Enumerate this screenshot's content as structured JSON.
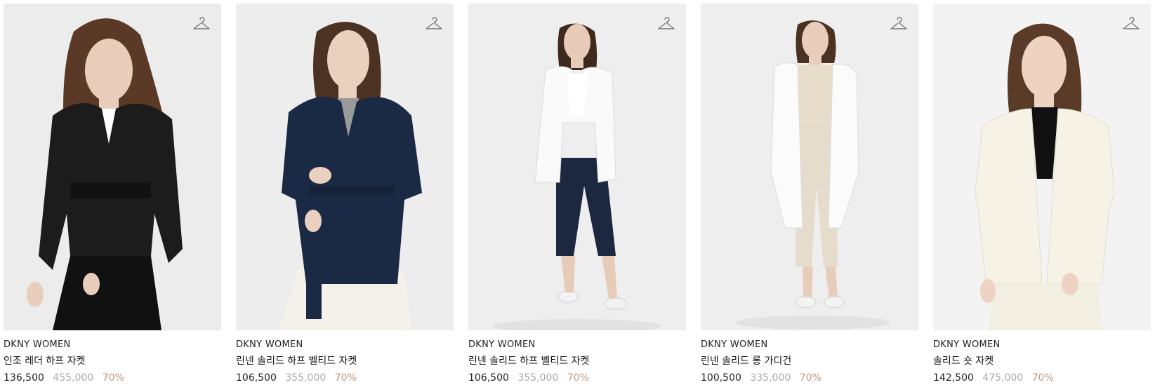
{
  "products": [
    {
      "brand": "DKNY WOMEN",
      "name": "인조 레더 하프 자켓",
      "price": "136,500",
      "original_price": "455,000",
      "discount": "70%",
      "image_alt": "black faux leather jacket",
      "colors": {
        "jacket": "#1c1c1c",
        "inner": "#ffffff",
        "bottom": "#111111",
        "hair": "#5a3a26",
        "skin": "#e9cdbb",
        "bg": "#ececec"
      },
      "icon": "hanger-icon"
    },
    {
      "brand": "DKNY WOMEN",
      "name": "린넨 솔리드 하프 벨티드 자켓",
      "price": "106,500",
      "original_price": "355,000",
      "discount": "70%",
      "image_alt": "navy linen belted jacket",
      "colors": {
        "jacket": "#1b2a44",
        "inner": "#9a9a9a",
        "bottom": "#f4f1ea",
        "hair": "#4b3222",
        "skin": "#ead0bf",
        "bg": "#ededed"
      },
      "icon": "hanger-icon"
    },
    {
      "brand": "DKNY WOMEN",
      "name": "린넨 솔리드 하프 벨티드 자켓",
      "price": "106,500",
      "original_price": "355,000",
      "discount": "70%",
      "image_alt": "white linen belted jacket",
      "colors": {
        "jacket": "#fafafa",
        "inner": "#ffffff",
        "bottom": "#1c2740",
        "hair": "#3e2a1d",
        "skin": "#e7cbb8",
        "bg": "#eeeeee"
      },
      "icon": "hanger-icon"
    },
    {
      "brand": "DKNY WOMEN",
      "name": "린넨 솔리드 롱 가디건",
      "price": "100,500",
      "original_price": "335,000",
      "discount": "70%",
      "image_alt": "white linen long cardigan",
      "colors": {
        "jacket": "#fbfbfb",
        "inner": "#e8dccb",
        "bottom": "#e6dccc",
        "hair": "#4a3122",
        "skin": "#e8cdbc",
        "bg": "#eeeeee"
      },
      "icon": "hanger-icon"
    },
    {
      "brand": "DKNY WOMEN",
      "name": "솔리드 숏 자켓",
      "price": "142,500",
      "original_price": "475,000",
      "discount": "70%",
      "image_alt": "cream short jacket",
      "colors": {
        "jacket": "#f6f2e6",
        "inner": "#111111",
        "bottom": "#f2eee2",
        "hair": "#5a3b27",
        "skin": "#eed3c2",
        "bg": "#f3f3f3"
      },
      "icon": "hanger-icon"
    }
  ]
}
